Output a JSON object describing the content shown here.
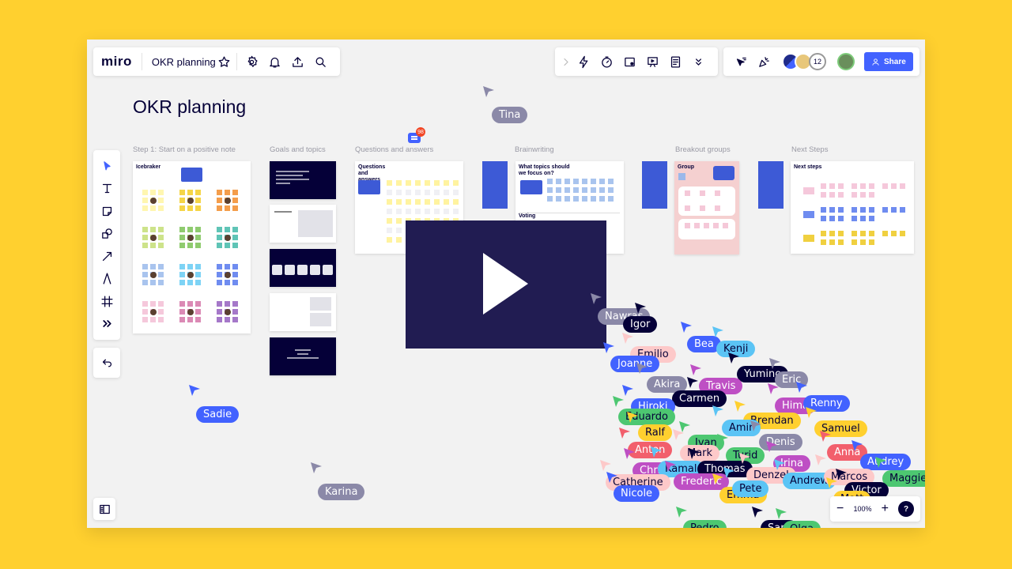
{
  "app": {
    "logo": "miro",
    "board_title": "OKR planning",
    "share_label": "Share",
    "collaborator_count": "12",
    "zoom_level": "100%",
    "help_label": "?",
    "comment_badge": "98"
  },
  "toolbar": {
    "tools": [
      "select-icon",
      "text-icon",
      "sticky-note-icon",
      "shapes-icon",
      "arrow-icon",
      "pen-icon",
      "frame-icon",
      "more-icon"
    ]
  },
  "board": {
    "heading": "OKR planning",
    "sections": [
      "Step 1: Start on a positive note",
      "Goals and topics",
      "Questions and answers",
      "Brainwriting",
      "Breakout groups",
      "Next Steps"
    ],
    "frames": {
      "icebreaker": "Icebraker",
      "qa": "Questions and answers",
      "brainwriting": "What topics should we focus on?",
      "voting": "Voting",
      "group": "Group",
      "next_steps": "Next steps"
    }
  },
  "colors": {
    "accent": "#4262FF",
    "background": "#FFD02F",
    "canvas": "#F2F2F2",
    "video": "#211C52"
  },
  "cursors": [
    {
      "name": "Tina",
      "color": "#8B89A8",
      "text": "#fff"
    },
    {
      "name": "Sadie",
      "color": "#4262FF",
      "text": "#fff"
    },
    {
      "name": "Karina",
      "color": "#8B89A8",
      "text": "#fff"
    },
    {
      "name": "Nawras",
      "color": "#8B89A8",
      "text": "#fff"
    },
    {
      "name": "Igor",
      "color": "#050038",
      "text": "#fff"
    },
    {
      "name": "Bea",
      "color": "#4262FF",
      "text": "#fff"
    },
    {
      "name": "Kenji",
      "color": "#5BC4F5",
      "text": "#050038"
    },
    {
      "name": "Emilio",
      "color": "#FDC9C9",
      "text": "#050038"
    },
    {
      "name": "Joanne",
      "color": "#4262FF",
      "text": "#fff"
    },
    {
      "name": "Yumino",
      "color": "#050038",
      "text": "#fff"
    },
    {
      "name": "Eric",
      "color": "#8B89A8",
      "text": "#fff"
    },
    {
      "name": "Akira",
      "color": "#8B89A8",
      "text": "#fff"
    },
    {
      "name": "Travis",
      "color": "#BE4FC4",
      "text": "#fff"
    },
    {
      "name": "Carmen",
      "color": "#050038",
      "text": "#fff"
    },
    {
      "name": "Hiroki",
      "color": "#4262FF",
      "text": "#fff"
    },
    {
      "name": "Hima",
      "color": "#BE4FC4",
      "text": "#fff"
    },
    {
      "name": "Renny",
      "color": "#4262FF",
      "text": "#fff"
    },
    {
      "name": "Eduardo",
      "color": "#4DC771",
      "text": "#050038"
    },
    {
      "name": "Brendan",
      "color": "#FFD02F",
      "text": "#050038"
    },
    {
      "name": "Amir",
      "color": "#5BC4F5",
      "text": "#050038"
    },
    {
      "name": "Samuel",
      "color": "#FFD02F",
      "text": "#050038"
    },
    {
      "name": "Ralf",
      "color": "#FFD02F",
      "text": "#050038"
    },
    {
      "name": "Ivan",
      "color": "#4DC771",
      "text": "#050038"
    },
    {
      "name": "Denis",
      "color": "#8B89A8",
      "text": "#fff"
    },
    {
      "name": "Anton",
      "color": "#F25F6C",
      "text": "#fff"
    },
    {
      "name": "Mark",
      "color": "#FDC9C9",
      "text": "#050038"
    },
    {
      "name": "Turid",
      "color": "#4DC771",
      "text": "#050038"
    },
    {
      "name": "Anna",
      "color": "#F25F6C",
      "text": "#fff"
    },
    {
      "name": "Irina",
      "color": "#BE4FC4",
      "text": "#fff"
    },
    {
      "name": "Audrey",
      "color": "#4262FF",
      "text": "#fff"
    },
    {
      "name": "Chris",
      "color": "#BE4FC4",
      "text": "#fff"
    },
    {
      "name": "Kamal",
      "color": "#5BC4F5",
      "text": "#050038"
    },
    {
      "name": "Thomas",
      "color": "#050038",
      "text": "#fff"
    },
    {
      "name": "Denzel",
      "color": "#FDC9C9",
      "text": "#050038"
    },
    {
      "name": "Andrew",
      "color": "#5BC4F5",
      "text": "#050038"
    },
    {
      "name": "Marcos",
      "color": "#FDC9C9",
      "text": "#050038"
    },
    {
      "name": "Maggie",
      "color": "#4DC771",
      "text": "#050038"
    },
    {
      "name": "Catherine",
      "color": "#FDC9C9",
      "text": "#050038"
    },
    {
      "name": "Frederic",
      "color": "#BE4FC4",
      "text": "#fff"
    },
    {
      "name": "Victor",
      "color": "#050038",
      "text": "#fff"
    },
    {
      "name": "Nicole",
      "color": "#4262FF",
      "text": "#fff"
    },
    {
      "name": "Emma",
      "color": "#FFD02F",
      "text": "#050038"
    },
    {
      "name": "Pete",
      "color": "#5BC4F5",
      "text": "#050038"
    },
    {
      "name": "Matt",
      "color": "#FFD02F",
      "text": "#050038"
    },
    {
      "name": "Pedro",
      "color": "#4DC771",
      "text": "#050038"
    },
    {
      "name": "Sam",
      "color": "#050038",
      "text": "#fff"
    },
    {
      "name": "Olga",
      "color": "#4DC771",
      "text": "#050038"
    }
  ]
}
